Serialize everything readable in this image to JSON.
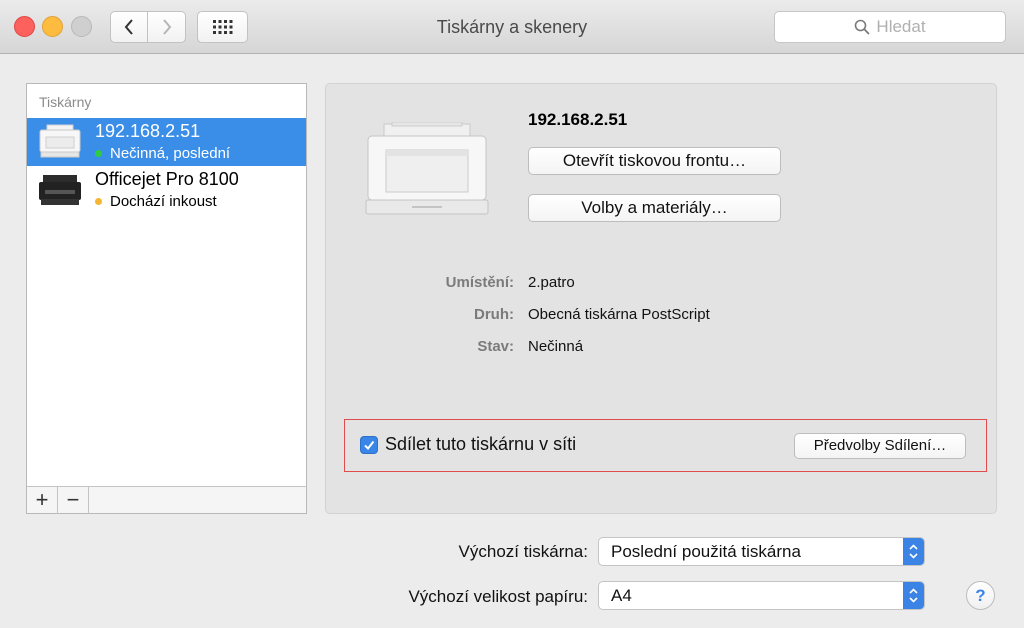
{
  "window": {
    "title": "Tiskárny a skenery",
    "search_placeholder": "Hledat"
  },
  "printer_list": {
    "header": "Tiskárny",
    "items": [
      {
        "name": "192.168.2.51",
        "status": "Nečinná, poslední",
        "status_color": "#2ecc40",
        "selected": true
      },
      {
        "name": "Officejet Pro 8100",
        "status": "Dochází inkoust",
        "status_color": "#f5b731",
        "selected": false
      }
    ],
    "add_label": "+",
    "remove_label": "−"
  },
  "detail": {
    "printer_name": "192.168.2.51",
    "open_queue_label": "Otevřít tiskovou frontu…",
    "options_label": "Volby a materiály…",
    "info": [
      {
        "label": "Umístění:",
        "value": "2.patro"
      },
      {
        "label": "Druh:",
        "value": "Obecná tiskárna PostScript"
      },
      {
        "label": "Stav:",
        "value": "Nečinná"
      }
    ],
    "share_label": "Sdílet tuto tiskárnu v síti",
    "share_checked": true,
    "sharing_prefs_label": "Předvolby Sdílení…"
  },
  "settings": {
    "default_printer_label": "Výchozí tiskárna:",
    "default_printer_value": "Poslední použitá tiskárna",
    "paper_size_label": "Výchozí velikost papíru:",
    "paper_size_value": "A4"
  },
  "help_label": "?",
  "colors": {
    "accent": "#3b8ee8",
    "highlight_box": "#e04b4b"
  }
}
